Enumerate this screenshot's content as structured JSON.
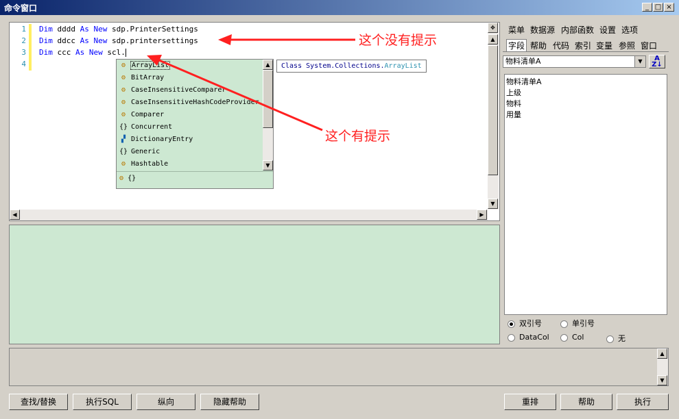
{
  "window": {
    "title": "命令窗口",
    "btn_min": "_",
    "btn_max": "□",
    "btn_close": "×"
  },
  "editor": {
    "line_numbers": [
      "1",
      "2",
      "3",
      "4"
    ],
    "lines": [
      {
        "kw1": "Dim",
        "name": "dddd",
        "kw2": "As",
        "kw3": "New",
        "rest": "sdp.PrinterSettings"
      },
      {
        "kw1": "Dim",
        "name": "ddcc",
        "kw2": "As",
        "kw3": "New",
        "rest": "sdp.printersettings"
      },
      {
        "kw1": "Dim",
        "name": "ccc",
        "kw2": "As",
        "kw3": "New",
        "rest": "scl."
      }
    ]
  },
  "autocomplete": {
    "items": [
      {
        "label": "ArrayList",
        "icon": "class-icon",
        "glyph": "⚙"
      },
      {
        "label": "BitArray",
        "icon": "class-icon",
        "glyph": "⚙"
      },
      {
        "label": "CaseInsensitiveComparer",
        "icon": "class-icon",
        "glyph": "⚙"
      },
      {
        "label": "CaseInsensitiveHashCodeProvider",
        "icon": "class-icon",
        "glyph": "⚙"
      },
      {
        "label": "Comparer",
        "icon": "class-icon",
        "glyph": "⚙"
      },
      {
        "label": "Concurrent",
        "icon": "namespace-icon",
        "glyph": "{}"
      },
      {
        "label": "DictionaryEntry",
        "icon": "struct-icon",
        "glyph": "▞"
      },
      {
        "label": "Generic",
        "icon": "namespace-icon",
        "glyph": "{}"
      },
      {
        "label": "Hashtable",
        "icon": "class-icon",
        "glyph": "⚙"
      }
    ],
    "footer_glyph": "{}"
  },
  "tooltip": {
    "prefix": "Class System.Collections.",
    "cls": "ArrayList"
  },
  "annotations": {
    "no_hint": "这个没有提示",
    "has_hint": "这个有提示"
  },
  "right_panel": {
    "tabs_row1": [
      "菜单",
      "数据源",
      "内部函数",
      "设置",
      "选项"
    ],
    "tabs_row2": [
      "字段",
      "帮助",
      "代码",
      "索引",
      "变量",
      "参照",
      "窗口"
    ],
    "combo_value": "物料清单A",
    "list_items": [
      "物料清单A",
      "上级",
      "物料",
      "用量"
    ],
    "radios": [
      {
        "label": "双引号",
        "checked": true
      },
      {
        "label": "单引号",
        "checked": false
      },
      {
        "label": "DataCol",
        "checked": false
      },
      {
        "label": "Col",
        "checked": false
      },
      {
        "label": "无",
        "checked": false
      }
    ]
  },
  "buttons": {
    "find_replace": "查找/替换",
    "exec_sql": "执行SQL",
    "vertical": "纵向",
    "hide_help": "隐藏帮助",
    "rearrange": "重排",
    "help": "帮助",
    "execute": "执行"
  },
  "colors": {
    "arrow": "#ff2020",
    "popup_bg": "#cde8d2",
    "keyword": "#0000ff"
  }
}
